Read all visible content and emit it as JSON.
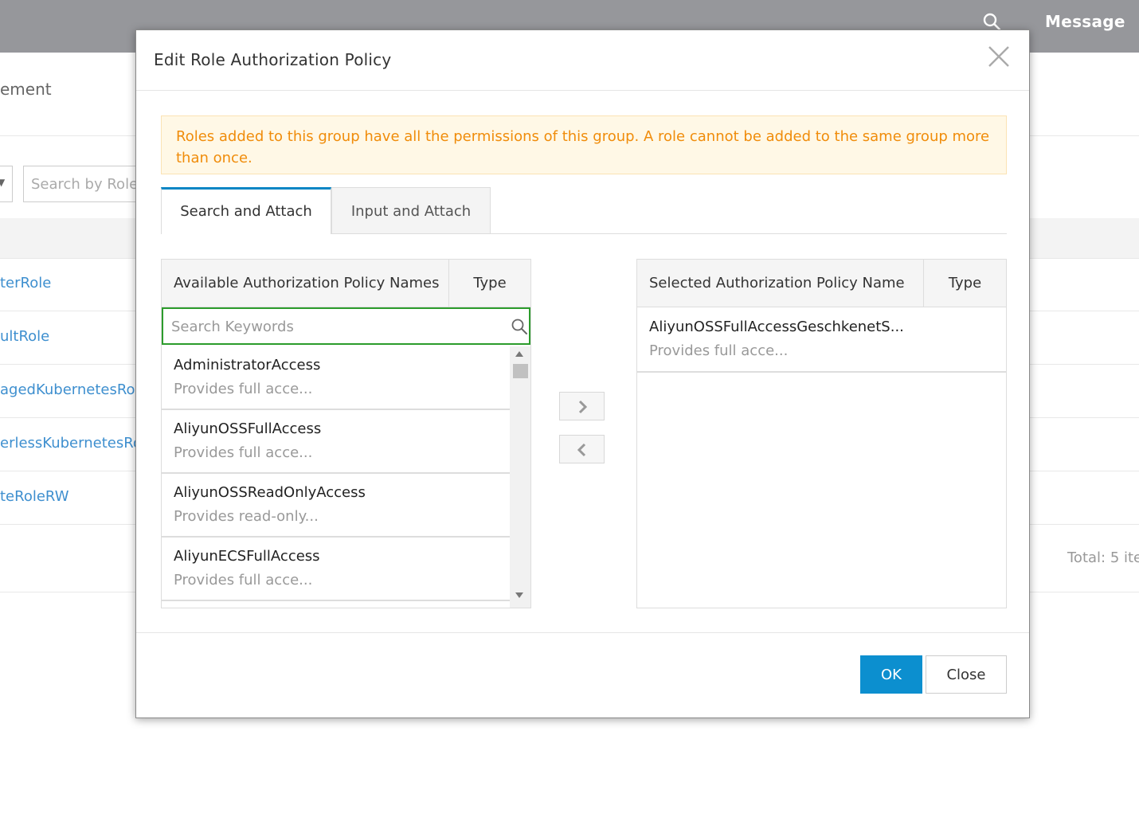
{
  "background": {
    "header": {
      "message_label": "Message"
    },
    "page_title_fragment": "ement",
    "search_placeholder_fragment": "Search by Role",
    "role_links": [
      "terRole",
      "ultRole",
      "agedKubernetesRol",
      "erlessKubernetesRo",
      "teRoleRW"
    ],
    "total_fragment": "Total: 5 ite"
  },
  "dialog": {
    "title": "Edit Role Authorization Policy",
    "notice": "Roles added to this group have all the permissions of this group. A role cannot be added to the same group more than once.",
    "tabs": [
      {
        "label": "Search and Attach",
        "active": true
      },
      {
        "label": "Input and Attach",
        "active": false
      }
    ],
    "available": {
      "header_name": "Available Authorization Policy Names",
      "header_type": "Type",
      "search_placeholder": "Search Keywords",
      "items": [
        {
          "name": "AdministratorAccess",
          "desc": "Provides full acce..."
        },
        {
          "name": "AliyunOSSFullAccess",
          "desc": "Provides full acce..."
        },
        {
          "name": "AliyunOSSReadOnlyAccess",
          "desc": "Provides read-only..."
        },
        {
          "name": "AliyunECSFullAccess",
          "desc": "Provides full acce..."
        }
      ]
    },
    "selected": {
      "header_name": "Selected Authorization Policy Name",
      "header_type": "Type",
      "items": [
        {
          "name": "AliyunOSSFullAccessGeschkenetS...",
          "desc": "Provides full acce..."
        }
      ]
    },
    "buttons": {
      "ok": "OK",
      "close": "Close"
    }
  },
  "colors": {
    "primary": "#0c8fcf",
    "notice_text": "#f08c0a",
    "notice_bg": "#fff8e6",
    "link": "#3e8fcf",
    "search_focus_border": "#2c9c2c",
    "topbar": "#96979b"
  },
  "icons": {
    "header_search": "search-icon",
    "dialog_close": "close-icon",
    "keyword_search": "search-icon",
    "move_right": "chevron-right-icon",
    "move_left": "chevron-left-icon"
  }
}
